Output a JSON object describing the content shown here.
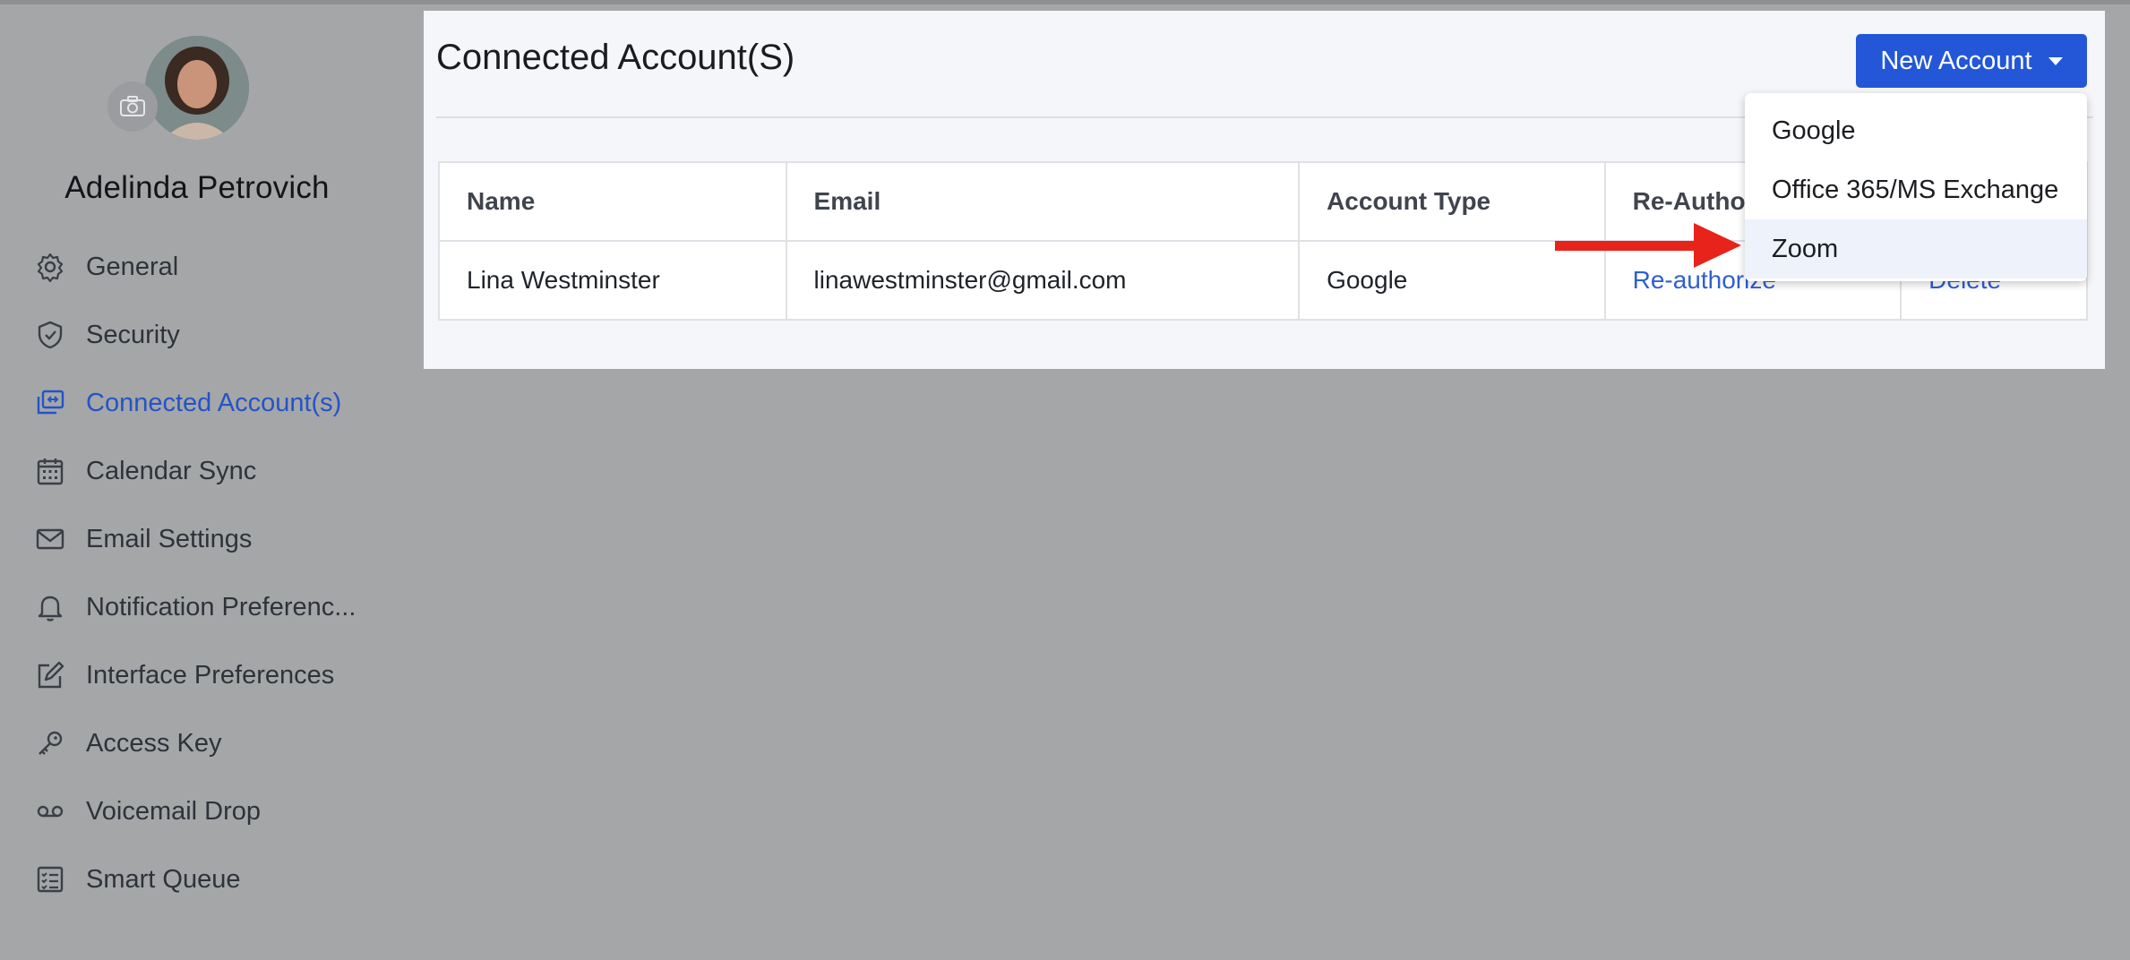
{
  "user": {
    "name": "Adelinda Petrovich"
  },
  "sidebar": {
    "items": [
      {
        "label": "General",
        "icon": "gear-icon"
      },
      {
        "label": "Security",
        "icon": "shield-icon"
      },
      {
        "label": "Connected Account(s)",
        "icon": "linked-accounts-icon",
        "active": true
      },
      {
        "label": "Calendar Sync",
        "icon": "calendar-icon"
      },
      {
        "label": "Email Settings",
        "icon": "envelope-icon"
      },
      {
        "label": "Notification Preferenc...",
        "icon": "bell-icon"
      },
      {
        "label": "Interface Preferences",
        "icon": "edit-square-icon"
      },
      {
        "label": "Access Key",
        "icon": "key-icon"
      },
      {
        "label": "Voicemail Drop",
        "icon": "voicemail-icon"
      },
      {
        "label": "Smart Queue",
        "icon": "checklist-icon"
      }
    ]
  },
  "main": {
    "title": "Connected Account(S)",
    "new_account_label": "New Account",
    "table": {
      "headers": [
        "Name",
        "Email",
        "Account Type",
        "Re-Autho",
        ""
      ],
      "rows": [
        {
          "name": "Lina Westminster",
          "email": "linawestminster@gmail.com",
          "type": "Google",
          "reauth": "Re-authorize",
          "delete": "Delete"
        }
      ]
    }
  },
  "dropdown": {
    "options": [
      "Google",
      "Office 365/MS Exchange",
      "Zoom"
    ],
    "highlighted": "Zoom"
  },
  "colors": {
    "accent": "#2357d8",
    "active_nav": "#2454c6",
    "overlay": "#a5a6a8",
    "annotation_arrow": "#e8231c"
  }
}
